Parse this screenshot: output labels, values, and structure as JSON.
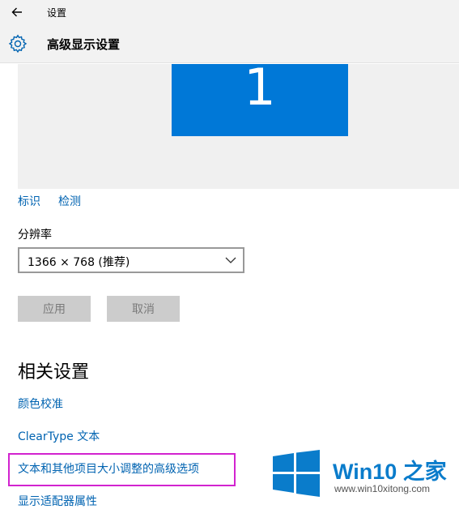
{
  "window": {
    "title": "设置"
  },
  "header": {
    "title": "高级显示设置"
  },
  "display": {
    "monitor_number": "1"
  },
  "display_links": {
    "identify": "标识",
    "detect": "检测"
  },
  "resolution": {
    "label": "分辨率",
    "value": "1366 × 768 (推荐)"
  },
  "buttons": {
    "apply": "应用",
    "cancel": "取消"
  },
  "related": {
    "title": "相关设置",
    "links": [
      "颜色校准",
      "ClearType 文本",
      "文本和其他项目大小调整的高级选项",
      "显示适配器属性"
    ]
  },
  "watermark": {
    "brand": "Win10",
    "suffix": "之家",
    "url": "www.win10xitong.com"
  },
  "colors": {
    "accent": "#0078d7",
    "link": "#0063b1",
    "highlight": "#d223cf"
  }
}
